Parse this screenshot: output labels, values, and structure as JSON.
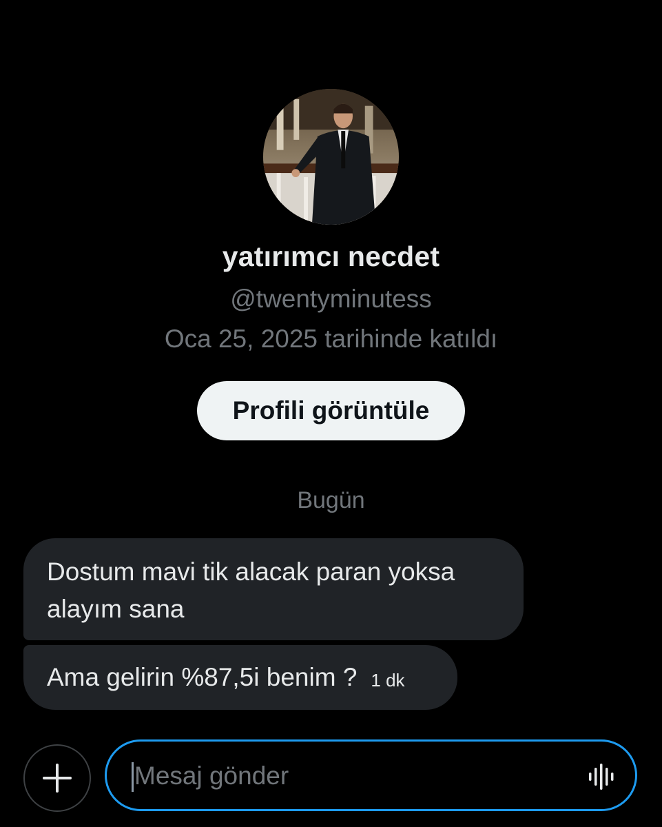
{
  "profile": {
    "display_name": "yatırımcı necdet",
    "handle": "@twentyminutess",
    "joined": "Oca 25, 2025 tarihinde katıldı",
    "view_profile_label": "Profili görüntüle"
  },
  "conversation": {
    "date_separator": "Bugün",
    "messages": [
      {
        "text": "Dostum mavi tik alacak paran yoksa alayım sana",
        "time": ""
      },
      {
        "text": "Ama gelirin %87,5i benim ?",
        "time": "1 dk"
      }
    ]
  },
  "composer": {
    "placeholder": "Mesaj gönder",
    "value": "",
    "add_icon": "plus-icon",
    "voice_icon": "voice-wave-icon"
  },
  "colors": {
    "background": "#000000",
    "bubble": "#202327",
    "accent": "#1d9bf0",
    "muted_text": "#71767b",
    "button_bg": "#eff3f4"
  }
}
